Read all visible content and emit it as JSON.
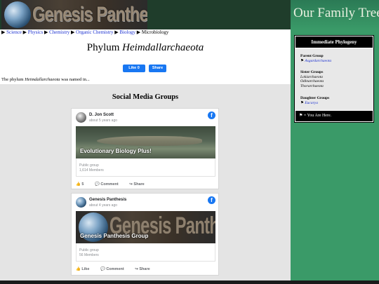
{
  "header": {
    "logo_text": "Genesis Panthesis",
    "family_tree": "Our Family Tree"
  },
  "breadcrumb": {
    "items": [
      "Science",
      "Physics",
      "Chemistry",
      "Organic Chemistry",
      "Biology"
    ],
    "current": "Microbiology",
    "separator": "▶"
  },
  "main": {
    "title_prefix": "Phylum ",
    "title_name": "Heimdallarchaeota",
    "like_label": "Like 0",
    "share_label": "Share",
    "intro_prefix": "The phylum ",
    "intro_name": "Heimdallarchaeota",
    "intro_suffix": " was named in..."
  },
  "social": {
    "heading": "Social Media Groups",
    "cards": [
      {
        "name": "D. Jon Scott",
        "time": "about 5 years ago",
        "banner_label": "Evolutionary Biology Plus!",
        "group_type": "Public group",
        "members": "1,614 Members",
        "actions": [
          "5",
          "Comment",
          "Share"
        ]
      },
      {
        "name": "Genesis Panthesis",
        "time": "about 4 years ago",
        "banner_text": "Genesis Panthesis",
        "banner_label": "Genesis Panthesis Group",
        "group_type": "Public group",
        "members": "56 Members",
        "actions": [
          "Like",
          "Comment",
          "Share"
        ]
      }
    ]
  },
  "phylogeny": {
    "heading": "Immediate Phylogeny",
    "parent_label": "Parent Group",
    "parent": "Asgardarchaeota",
    "sister_label": "Sister Groups",
    "sisters": [
      "Lokiarchaeota",
      "Odinarchaeota",
      "Thorarchaeota"
    ],
    "daughter_label": "Daughter Groups",
    "daughter": "Eucarya",
    "you_are_here": "= You Are Here.",
    "flag": "⚑"
  },
  "colors": {
    "sidebar_bg": "#3a9a68",
    "link": "#1a2fd0",
    "facebook": "#1877f2"
  }
}
